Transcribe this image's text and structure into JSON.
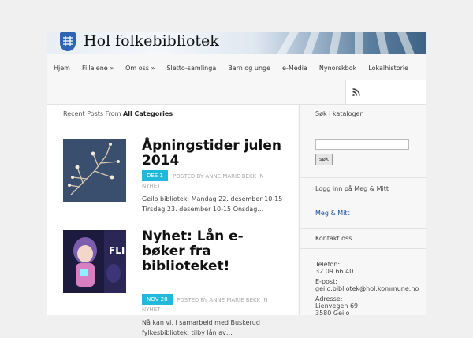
{
  "site": {
    "title": "Hol folkebibliotek"
  },
  "nav": {
    "items": [
      "Hjem",
      "Fillalene »",
      "Om oss »",
      "Sletto-samlinga",
      "Barn og unge",
      "e-Media",
      "Nynorskbok",
      "Lokalhistorie"
    ]
  },
  "recent": {
    "prefix": "Recent Posts From",
    "category": "All Categories"
  },
  "posts": [
    {
      "title": "Åpningstider julen 2014",
      "date": "DES 1",
      "meta_a": "POSTED BY ANNE MARIE BEKK IN",
      "meta_b": "NYHET",
      "excerpt": "Geilo bibliotek: Mandag 22. desember 10-15 Tirsdag 23. desember 10-15 Onsdag…"
    },
    {
      "title": "Nyhet: Lån e-bøker fra biblioteket!",
      "date": "NOV 28",
      "meta_a": "POSTED BY ANNE MARIE BEKK IN",
      "meta_b": "NYHET",
      "excerpt": "Nå kan vi, i samarbeid med Buskerud fylkesbibliotek, tilby lån av…"
    }
  ],
  "sidebar": {
    "search_title": "Søk i katalogen",
    "search_button": "søk",
    "login_title": "Logg inn på Meg & Mitt",
    "login_link": "Meg & Mitt",
    "contact_title": "Kontakt oss",
    "contact_lines": [
      "Telefon:",
      "32 09 66 40",
      "E-post:",
      "geilo.bibliotek@hol.kommune.no",
      "Adresse:",
      "Lienvegen 69",
      "3580 Geilo"
    ]
  },
  "colors": {
    "accent": "#21b9d9",
    "link": "#1a4fa0"
  },
  "icons": {
    "rss": "rss-icon",
    "crest": "crest-icon"
  }
}
